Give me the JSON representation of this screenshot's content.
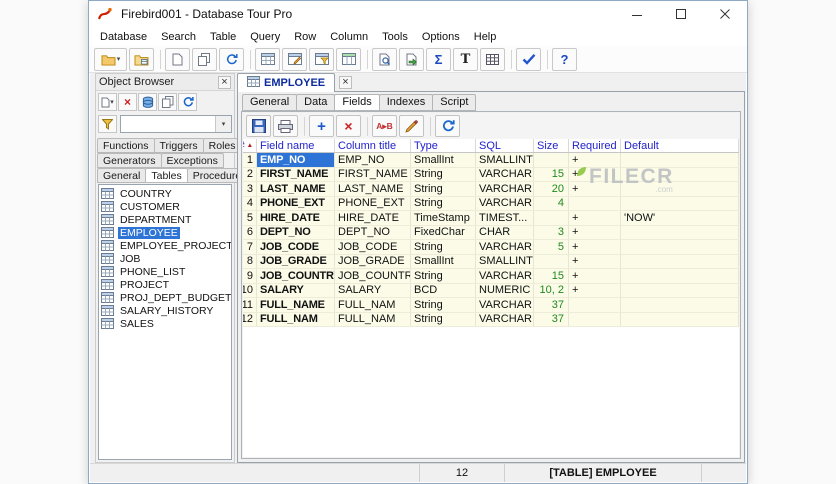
{
  "window": {
    "title": "Firebird001 - Database Tour Pro"
  },
  "menu": {
    "items": [
      "Database",
      "Search",
      "Table",
      "Query",
      "Row",
      "Column",
      "Tools",
      "Options",
      "Help"
    ]
  },
  "icons": {
    "dropdown": "▾",
    "close": "×",
    "plus": "+",
    "delete": "×",
    "sum": "Σ",
    "letter_t": "T",
    "help": "?",
    "rename": "A▸B",
    "sort_asc": "▲"
  },
  "object_browser": {
    "title": "Object Browser",
    "filter_value": "",
    "tabs": {
      "row1": [
        "Functions",
        "Triggers",
        "Roles"
      ],
      "row2": [
        "Generators",
        "Exceptions"
      ],
      "row3": [
        "General",
        "Tables",
        "Procedures"
      ]
    },
    "active_tab": "Tables",
    "tables": [
      "COUNTRY",
      "CUSTOMER",
      "DEPARTMENT",
      "EMPLOYEE",
      "EMPLOYEE_PROJECT",
      "JOB",
      "PHONE_LIST",
      "PROJECT",
      "PROJ_DEPT_BUDGET",
      "SALARY_HISTORY",
      "SALES"
    ],
    "selected_table": "EMPLOYEE"
  },
  "document": {
    "tab": "EMPLOYEE",
    "subtabs": [
      "General",
      "Data",
      "Fields",
      "Indexes",
      "Script"
    ],
    "active_subtab": "Fields"
  },
  "grid": {
    "columns": [
      "#",
      "Field name",
      "Column title",
      "Type",
      "SQL",
      "Size",
      "Required",
      "Default"
    ],
    "selected_row": 0,
    "rows": [
      {
        "n": "1",
        "field": "EMP_NO",
        "title": "EMP_NO",
        "type": "SmallInt",
        "sql": "SMALLINT",
        "size": "",
        "required": "+",
        "default": ""
      },
      {
        "n": "2",
        "field": "FIRST_NAME",
        "title": "FIRST_NAME",
        "type": "String",
        "sql": "VARCHAR",
        "size": "15",
        "required": "+",
        "default": ""
      },
      {
        "n": "3",
        "field": "LAST_NAME",
        "title": "LAST_NAME",
        "type": "String",
        "sql": "VARCHAR",
        "size": "20",
        "required": "+",
        "default": ""
      },
      {
        "n": "4",
        "field": "PHONE_EXT",
        "title": "PHONE_EXT",
        "type": "String",
        "sql": "VARCHAR",
        "size": "4",
        "required": "",
        "default": ""
      },
      {
        "n": "5",
        "field": "HIRE_DATE",
        "title": "HIRE_DATE",
        "type": "TimeStamp",
        "sql": "TIMEST...",
        "size": "",
        "required": "+",
        "default": "'NOW'"
      },
      {
        "n": "6",
        "field": "DEPT_NO",
        "title": "DEPT_NO",
        "type": "FixedChar",
        "sql": "CHAR",
        "size": "3",
        "required": "+",
        "default": ""
      },
      {
        "n": "7",
        "field": "JOB_CODE",
        "title": "JOB_CODE",
        "type": "String",
        "sql": "VARCHAR",
        "size": "5",
        "required": "+",
        "default": ""
      },
      {
        "n": "8",
        "field": "JOB_GRADE",
        "title": "JOB_GRADE",
        "type": "SmallInt",
        "sql": "SMALLINT",
        "size": "",
        "required": "+",
        "default": ""
      },
      {
        "n": "9",
        "field": "JOB_COUNTRY",
        "title": "JOB_COUNTRY",
        "type": "String",
        "sql": "VARCHAR",
        "size": "15",
        "required": "+",
        "default": ""
      },
      {
        "n": "10",
        "field": "SALARY",
        "title": "SALARY",
        "type": "BCD",
        "sql": "NUMERIC",
        "size": "10, 2",
        "required": "+",
        "default": ""
      },
      {
        "n": "11",
        "field": "FULL_NAME",
        "title": "FULL_NAM",
        "type": "String",
        "sql": "VARCHAR",
        "size": "37",
        "required": "",
        "default": ""
      },
      {
        "n": "12",
        "field": "FULL_NAM",
        "title": "FULL_NAM",
        "type": "String",
        "sql": "VARCHAR",
        "size": "37",
        "required": "",
        "default": ""
      }
    ]
  },
  "status": {
    "row_count": "12",
    "object": "[TABLE] EMPLOYEE"
  },
  "watermark": {
    "text": "FILECR",
    "suffix": ".com"
  }
}
